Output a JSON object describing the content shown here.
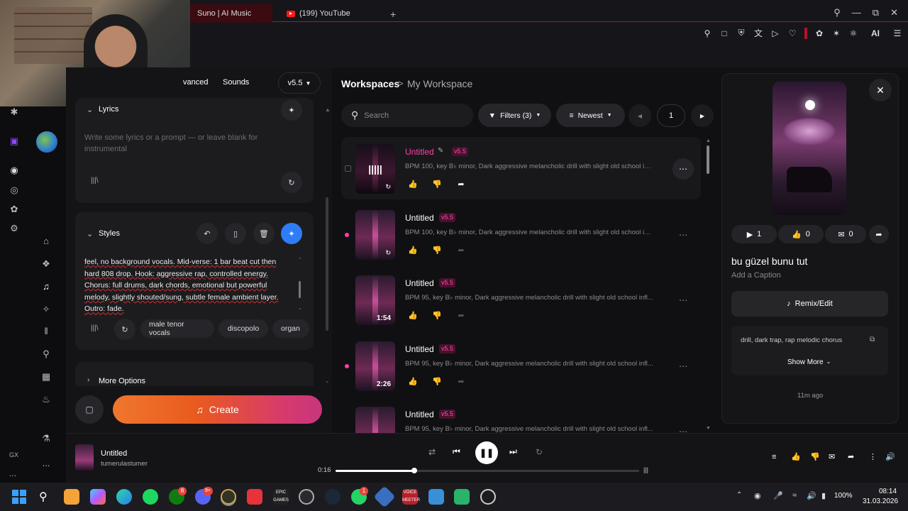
{
  "browser": {
    "tabs": [
      {
        "label": "Suno | AI Music",
        "active": true
      },
      {
        "label": "(199) YouTube",
        "active": false
      }
    ],
    "new_tab": "+",
    "ext_ai_label": "AI"
  },
  "create_panel": {
    "mode_tabs": [
      "Advanced",
      "Sounds"
    ],
    "mode_tab_partial": "vanced",
    "model_select": "v5.5",
    "lyrics": {
      "header": "Lyrics",
      "placeholder": "Write some lyrics or a prompt — or leave blank for instrumental"
    },
    "styles": {
      "header": "Styles",
      "text": "feel, no background vocals. Mid-verse: 1 bar beat cut then hard 808 drop. Hook: aggressive rap, controlled energy. Chorus: full drums, dark chords, emotional but powerful melody, slightly shouted/sung, subtle female ambient layer. Outro: fade.",
      "tags": [
        "male tenor vocals",
        "discopolo",
        "organ"
      ]
    },
    "more_options": "More Options",
    "create_label": "Create"
  },
  "workspace": {
    "breadcrumb_root": "Workspaces",
    "breadcrumb_sep": ">",
    "breadcrumb_current": "My Workspace",
    "search_placeholder": "Search",
    "filters_label": "Filters (3)",
    "sort_label": "Newest",
    "page": "1",
    "songs": [
      {
        "title": "Untitled",
        "version": "v5.5",
        "desc": "BPM 100, key B♭ minor, Dark aggressive melancholic drill with slight old school in...",
        "duration": "",
        "playing": true,
        "highlighted": true,
        "dot": false
      },
      {
        "title": "Untitled",
        "version": "v5.5",
        "desc": "BPM 100, key B♭ minor, Dark aggressive melancholic drill with slight old school in...",
        "duration": "",
        "playing": false,
        "highlighted": false,
        "dot": true
      },
      {
        "title": "Untitled",
        "version": "v5.5",
        "desc": "BPM 95, key B♭ minor, Dark aggressive melancholic drill with slight old school infl...",
        "duration": "1:54",
        "playing": false,
        "highlighted": false,
        "dot": false
      },
      {
        "title": "Untitled",
        "version": "v5.5",
        "desc": "BPM 95, key B♭ minor, Dark aggressive melancholic drill with slight old school infl...",
        "duration": "2:26",
        "playing": false,
        "highlighted": false,
        "dot": true
      },
      {
        "title": "Untitled",
        "version": "v5.5",
        "desc": "BPM 95, key B♭ minor, Dark aggressive melancholic drill with slight old school infl...",
        "duration": "",
        "playing": false,
        "highlighted": false,
        "dot": false
      }
    ]
  },
  "details": {
    "plays": "1",
    "likes": "0",
    "comments": "0",
    "title": "bu güzel bunu tut",
    "caption": "Add a Caption",
    "remix_label": "Remix/Edit",
    "style_tags": "drill, dark trap, rap melodic chorus",
    "show_more": "Show More",
    "time_ago": "11m ago"
  },
  "player": {
    "title": "Untitled",
    "artist": "tumerulastumer",
    "elapsed": "0:16",
    "progress": 0.26
  },
  "taskbar": {
    "battery": "100%",
    "time": "08:14",
    "date": "31.03.2026",
    "badges": {
      "xbox": "8",
      "discord": "9+",
      "whatsapp": "1"
    },
    "voicemeeter": "VOICE MEETER",
    "epic": "EPIC GAMES"
  },
  "rail": {
    "gx_label": "GX",
    "more_label": "..."
  },
  "colors": {
    "accent_pink": "#ff3fa8",
    "create_gradient_start": "#f0772d",
    "create_gradient_end": "#c8357f",
    "highlight_blue": "#2f7df6",
    "browser_red": "#b0142a"
  }
}
